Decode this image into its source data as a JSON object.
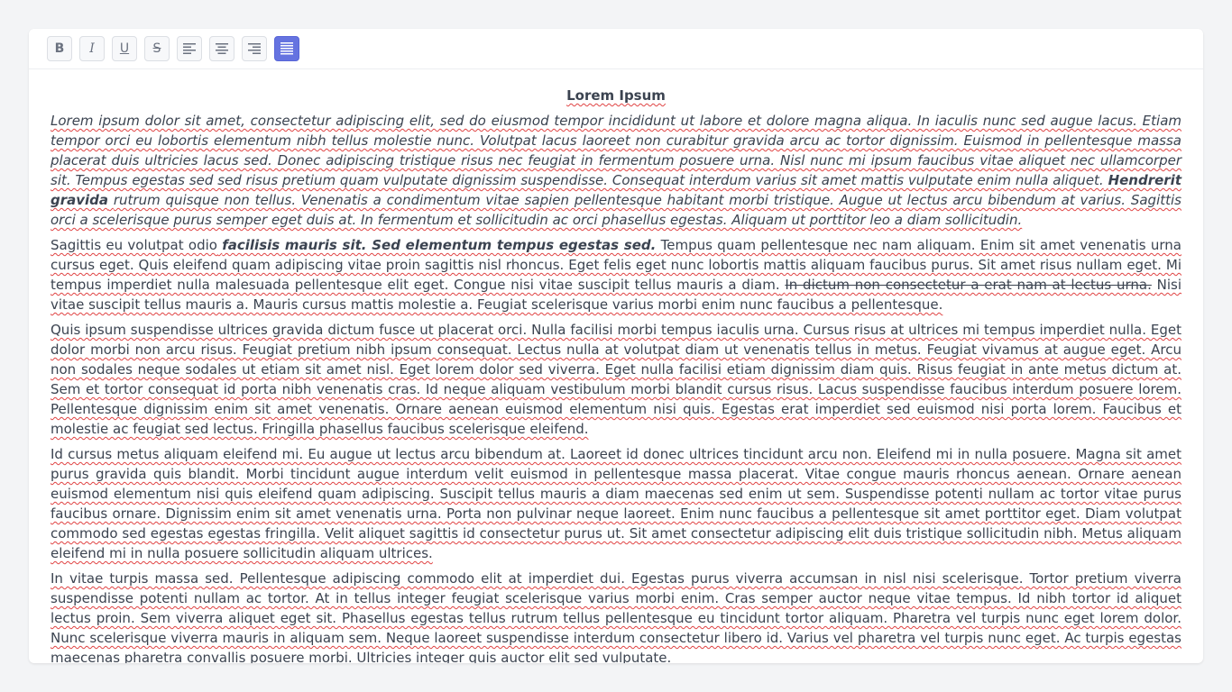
{
  "toolbar": {
    "buttons": [
      {
        "name": "bold",
        "glyph": "B",
        "active": false
      },
      {
        "name": "italic",
        "glyph": "I",
        "active": false
      },
      {
        "name": "underline",
        "glyph": "U",
        "active": false
      },
      {
        "name": "strikethrough",
        "glyph": "S",
        "active": false
      },
      {
        "name": "align-left",
        "active": false
      },
      {
        "name": "align-center",
        "active": false
      },
      {
        "name": "align-right",
        "active": false
      },
      {
        "name": "align-justify",
        "active": true
      }
    ],
    "accent_color": "#6573e0"
  },
  "document": {
    "title": "Lorem Ipsum",
    "p1": "Lorem ipsum dolor sit amet, consectetur adipiscing elit, sed do eiusmod tempor incididunt ut labore et dolore magna aliqua. In iaculis nunc sed augue lacus. Etiam tempor orci eu lobortis elementum nibh tellus molestie nunc. Volutpat lacus laoreet non curabitur gravida arcu ac tortor dignissim. Euismod in pellentesque massa placerat duis ultricies lacus sed. Donec adipiscing tristique risus nec feugiat in fermentum posuere urna. Nisl nunc mi ipsum faucibus vitae aliquet nec ullamcorper sit. Tempus egestas sed sed risus pretium quam vulputate dignissim suspendisse. Consequat interdum varius sit amet mattis vulputate enim nulla aliquet.",
    "p1_bold": "Hendrerit gravida",
    "p1_end": "rutrum quisque non tellus. Venenatis a condimentum vitae sapien pellentesque habitant morbi tristique. Augue ut lectus arcu bibendum at varius. Sagittis orci a scelerisque purus semper eget duis at. In fermentum et sollicitudin ac orci phasellus egestas. Aliquam ut porttitor leo a diam sollicitudin.",
    "p2_start": "Sagittis eu volutpat odio",
    "p2_bold": "facilisis mauris sit. Sed elementum tempus egestas sed.",
    "p2_mid": "Tempus quam pellentesque nec nam aliquam. Enim sit amet venenatis urna cursus eget. Quis eleifend quam adipiscing vitae proin sagittis nisl rhoncus. Eget felis eget nunc lobortis mattis aliquam faucibus purus. Sit amet risus nullam eget. Mi tempus imperdiet nulla malesuada pellentesque elit eget. Congue nisi vitae suscipit tellus mauris a diam.",
    "p2_strike": "In dictum non consectetur a erat nam at lectus urna.",
    "p2_end": "Nisi vitae suscipit tellus mauris a. Mauris cursus mattis molestie a. Feugiat scelerisque varius morbi enim nunc faucibus a pellentesque.",
    "p3": "Quis ipsum suspendisse ultrices gravida dictum fusce ut placerat orci. Nulla facilisi morbi tempus iaculis urna. Cursus risus at ultrices mi tempus imperdiet nulla. Eget dolor morbi non arcu risus. Feugiat pretium nibh ipsum consequat. Lectus nulla at volutpat diam ut venenatis tellus in metus. Feugiat vivamus at augue eget. Arcu non sodales neque sodales ut etiam sit amet nisl. Eget lorem dolor sed viverra. Eget nulla facilisi etiam dignissim diam quis. Risus feugiat in ante metus dictum at. Sem et tortor consequat id porta nibh venenatis cras. Id neque aliquam vestibulum morbi blandit cursus risus. Lacus suspendisse faucibus interdum posuere lorem. Pellentesque dignissim enim sit amet venenatis. Ornare aenean euismod elementum nisi quis. Egestas erat imperdiet sed euismod nisi porta lorem. Faucibus et molestie ac feugiat sed lectus. Fringilla phasellus faucibus scelerisque eleifend.",
    "p4": "Id cursus metus aliquam eleifend mi. Eu augue ut lectus arcu bibendum at. Laoreet id donec ultrices tincidunt arcu non. Eleifend mi in nulla posuere. Magna sit amet purus gravida quis blandit. Morbi tincidunt augue interdum velit euismod in pellentesque massa placerat. Vitae congue mauris rhoncus aenean. Ornare aenean euismod elementum nisi quis eleifend quam adipiscing. Suscipit tellus mauris a diam maecenas sed enim ut sem. Suspendisse potenti nullam ac tortor vitae purus faucibus ornare. Dignissim enim sit amet venenatis urna. Porta non pulvinar neque laoreet. Enim nunc faucibus a pellentesque sit amet porttitor eget. Diam volutpat commodo sed egestas egestas fringilla. Velit aliquet sagittis id consectetur purus ut. Sit amet consectetur adipiscing elit duis tristique sollicitudin nibh. Metus aliquam eleifend mi in nulla posuere sollicitudin aliquam ultrices.",
    "p5": "In vitae turpis massa sed. Pellentesque adipiscing commodo elit at imperdiet dui. Egestas purus viverra accumsan in nisl nisi scelerisque. Tortor pretium viverra suspendisse potenti nullam ac tortor. At in tellus integer feugiat scelerisque varius morbi enim. Cras semper auctor neque vitae tempus. Id nibh tortor id aliquet lectus proin. Sem viverra aliquet eget sit. Phasellus egestas tellus rutrum tellus pellentesque eu tincidunt tortor aliquam. Pharetra vel turpis nunc eget lorem dolor. Nunc scelerisque viverra mauris in aliquam sem. Neque laoreet suspendisse interdum consectetur libero id. Varius vel pharetra vel turpis nunc eget. Ac turpis egestas maecenas pharetra convallis posuere morbi. Ultricies integer quis auctor elit sed vulputate."
  }
}
